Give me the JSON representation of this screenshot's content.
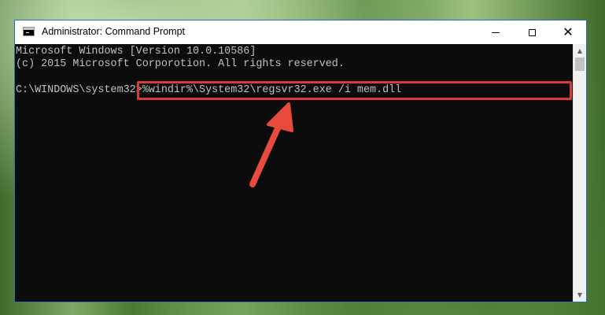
{
  "window": {
    "title": "Administrator: Command Prompt",
    "controls": {
      "minimize": "minimize",
      "maximize": "maximize",
      "close": "✕"
    }
  },
  "console": {
    "lines": [
      "Microsoft Windows [Version 10.0.10586]",
      "(c) 2015 Microsoft Corporotion. All rights reserved."
    ],
    "prompt": "C:\\WINDOWS\\system32>",
    "command": "%windir%\\System32\\regsvr32.exe /i mem.dll"
  },
  "annotation": {
    "highlight_color": "#d93a3a",
    "arrow_color": "#e84b3c"
  },
  "scrollbar": {
    "up_icon": "▲",
    "down_icon": "▼"
  },
  "icons": {
    "app": "cmd-console-icon",
    "arrow": "red-annotation-arrow"
  }
}
